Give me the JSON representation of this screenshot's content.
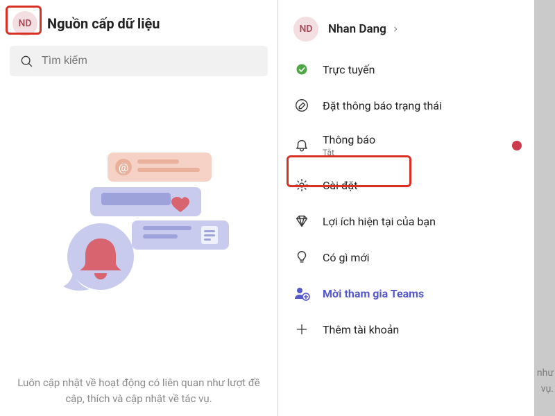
{
  "left": {
    "avatar_initials": "ND",
    "title": "Nguồn cấp dữ liệu",
    "search_placeholder": "Tìm kiếm",
    "caption": "Luôn cập nhật về hoạt động có liên quan như lượt đề cập, thích và cập nhật về tác vụ."
  },
  "profile": {
    "avatar_initials": "ND",
    "name": "Nhan Dang"
  },
  "menu": {
    "status_label": "Trực tuyến",
    "set_status_label": "Đặt thông báo trạng thái",
    "notifications_label": "Thông báo",
    "notifications_sub": "Tắt",
    "settings_label": "Cài đặt",
    "benefits_label": "Lợi ích hiện tại của bạn",
    "whats_new_label": "Có gì mới",
    "invite_label": "Mời tham gia Teams",
    "add_account_label": "Thêm tài khoản"
  },
  "backdrop": {
    "frag1": "n như",
    "frag2": "vụ."
  },
  "colors": {
    "highlight": "#d93025",
    "avatar_bg": "#f3dee2",
    "avatar_fg": "#a84c5a",
    "invite": "#5558c8",
    "online": "#4fa845"
  }
}
